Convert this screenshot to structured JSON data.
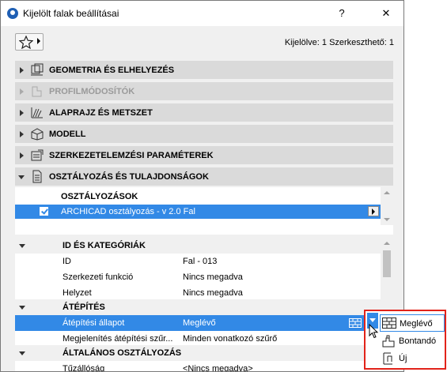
{
  "window": {
    "title": "Kijelölt falak beállításai",
    "help_label": "?",
    "close_label": "✕"
  },
  "toolbar": {
    "selection_info": "Kijelölve: 1 Szerkeszthető: 1"
  },
  "panels": [
    {
      "label": "GEOMETRIA ÉS ELHELYEZÉS",
      "icon": "geometry-icon",
      "enabled": true
    },
    {
      "label": "PROFILMÓDOSÍTÓK",
      "icon": "profile-icon",
      "enabled": false
    },
    {
      "label": "ALAPRAJZ ÉS METSZET",
      "icon": "floorplan-icon",
      "enabled": true
    },
    {
      "label": "MODELL",
      "icon": "model-icon",
      "enabled": true
    },
    {
      "label": "SZERKEZETELEMZÉSI PARAMÉTEREK",
      "icon": "structural-icon",
      "enabled": true
    },
    {
      "label": "OSZTÁLYOZÁS ÉS TULAJDONSÁGOK",
      "icon": "document-icon",
      "enabled": true,
      "expanded": true
    }
  ],
  "classifications": {
    "heading": "OSZTÁLYOZÁSOK",
    "row": "ARCHICAD osztályozás - v 2.0 Fal"
  },
  "properties": {
    "groups": [
      {
        "title": "ID ÉS KATEGÓRIÁK",
        "rows": [
          {
            "key": "ID",
            "value": "Fal - 013"
          },
          {
            "key": "Szerkezeti funkció",
            "value": "Nincs megadva"
          },
          {
            "key": "Helyzet",
            "value": "Nincs megadva"
          }
        ]
      },
      {
        "title": "ÁTÉPÍTÉS",
        "rows": [
          {
            "key": "Átépítési állapot",
            "value": "Meglévő",
            "selected": true
          },
          {
            "key": "Megjelenítés átépítési szűr...",
            "value": "Minden vonatkozó szűrő"
          }
        ]
      },
      {
        "title": "ÁLTALÁNOS OSZTÁLYOZÁS",
        "rows": [
          {
            "key": "Tűzállóság",
            "value": "<Nincs megadva>"
          }
        ]
      }
    ]
  },
  "status_menu": {
    "items": [
      {
        "label": "Meglévő",
        "icon": "existing-icon"
      },
      {
        "label": "Bontandó",
        "icon": "demolish-icon"
      },
      {
        "label": "Új",
        "icon": "new-icon"
      }
    ]
  },
  "colors": {
    "selection": "#3289e6",
    "highlight_border": "#e2231a",
    "panel_header": "#dadada"
  }
}
